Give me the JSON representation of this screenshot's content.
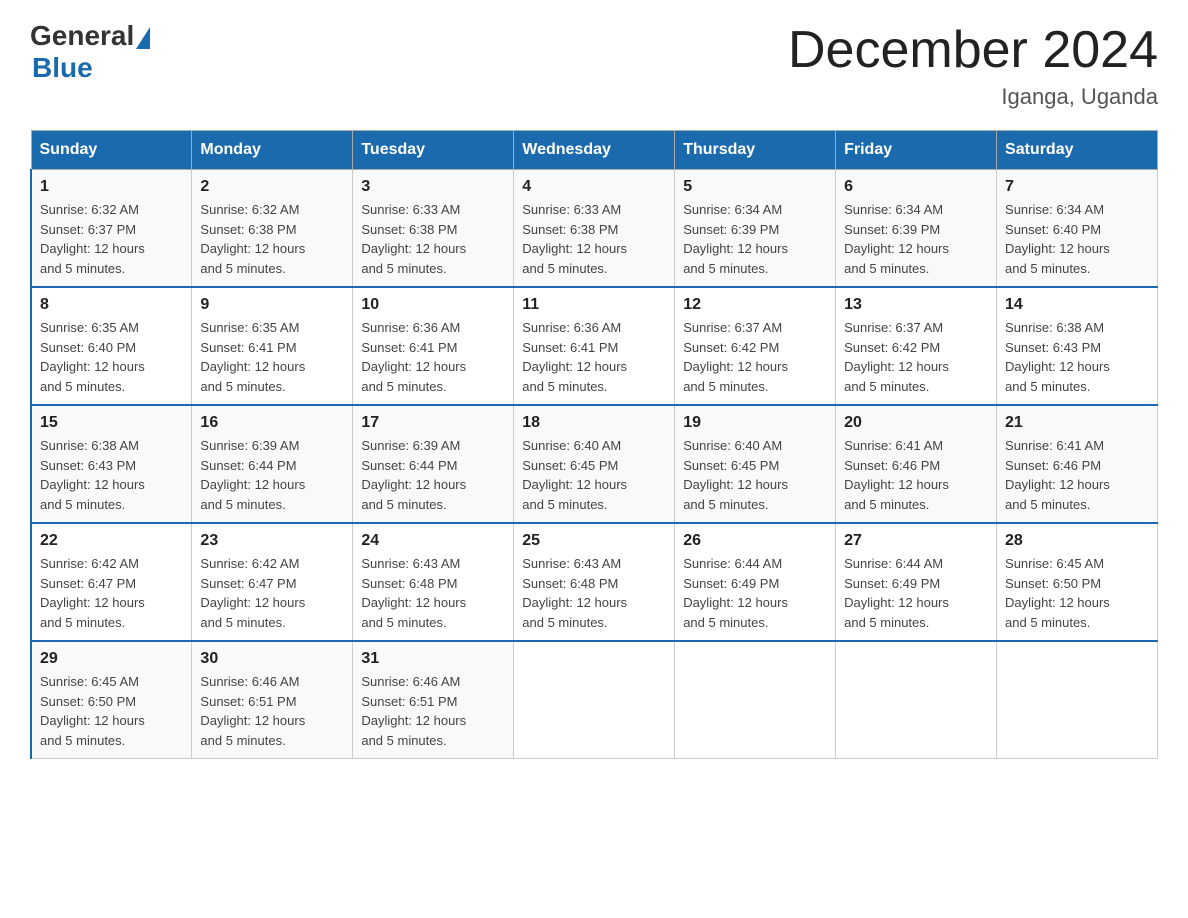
{
  "logo": {
    "general": "General",
    "blue": "Blue"
  },
  "title": "December 2024",
  "location": "Iganga, Uganda",
  "days_of_week": [
    "Sunday",
    "Monday",
    "Tuesday",
    "Wednesday",
    "Thursday",
    "Friday",
    "Saturday"
  ],
  "weeks": [
    [
      {
        "date": "1",
        "sunrise": "6:32 AM",
        "sunset": "6:37 PM",
        "daylight": "12 hours and 5 minutes."
      },
      {
        "date": "2",
        "sunrise": "6:32 AM",
        "sunset": "6:38 PM",
        "daylight": "12 hours and 5 minutes."
      },
      {
        "date": "3",
        "sunrise": "6:33 AM",
        "sunset": "6:38 PM",
        "daylight": "12 hours and 5 minutes."
      },
      {
        "date": "4",
        "sunrise": "6:33 AM",
        "sunset": "6:38 PM",
        "daylight": "12 hours and 5 minutes."
      },
      {
        "date": "5",
        "sunrise": "6:34 AM",
        "sunset": "6:39 PM",
        "daylight": "12 hours and 5 minutes."
      },
      {
        "date": "6",
        "sunrise": "6:34 AM",
        "sunset": "6:39 PM",
        "daylight": "12 hours and 5 minutes."
      },
      {
        "date": "7",
        "sunrise": "6:34 AM",
        "sunset": "6:40 PM",
        "daylight": "12 hours and 5 minutes."
      }
    ],
    [
      {
        "date": "8",
        "sunrise": "6:35 AM",
        "sunset": "6:40 PM",
        "daylight": "12 hours and 5 minutes."
      },
      {
        "date": "9",
        "sunrise": "6:35 AM",
        "sunset": "6:41 PM",
        "daylight": "12 hours and 5 minutes."
      },
      {
        "date": "10",
        "sunrise": "6:36 AM",
        "sunset": "6:41 PM",
        "daylight": "12 hours and 5 minutes."
      },
      {
        "date": "11",
        "sunrise": "6:36 AM",
        "sunset": "6:41 PM",
        "daylight": "12 hours and 5 minutes."
      },
      {
        "date": "12",
        "sunrise": "6:37 AM",
        "sunset": "6:42 PM",
        "daylight": "12 hours and 5 minutes."
      },
      {
        "date": "13",
        "sunrise": "6:37 AM",
        "sunset": "6:42 PM",
        "daylight": "12 hours and 5 minutes."
      },
      {
        "date": "14",
        "sunrise": "6:38 AM",
        "sunset": "6:43 PM",
        "daylight": "12 hours and 5 minutes."
      }
    ],
    [
      {
        "date": "15",
        "sunrise": "6:38 AM",
        "sunset": "6:43 PM",
        "daylight": "12 hours and 5 minutes."
      },
      {
        "date": "16",
        "sunrise": "6:39 AM",
        "sunset": "6:44 PM",
        "daylight": "12 hours and 5 minutes."
      },
      {
        "date": "17",
        "sunrise": "6:39 AM",
        "sunset": "6:44 PM",
        "daylight": "12 hours and 5 minutes."
      },
      {
        "date": "18",
        "sunrise": "6:40 AM",
        "sunset": "6:45 PM",
        "daylight": "12 hours and 5 minutes."
      },
      {
        "date": "19",
        "sunrise": "6:40 AM",
        "sunset": "6:45 PM",
        "daylight": "12 hours and 5 minutes."
      },
      {
        "date": "20",
        "sunrise": "6:41 AM",
        "sunset": "6:46 PM",
        "daylight": "12 hours and 5 minutes."
      },
      {
        "date": "21",
        "sunrise": "6:41 AM",
        "sunset": "6:46 PM",
        "daylight": "12 hours and 5 minutes."
      }
    ],
    [
      {
        "date": "22",
        "sunrise": "6:42 AM",
        "sunset": "6:47 PM",
        "daylight": "12 hours and 5 minutes."
      },
      {
        "date": "23",
        "sunrise": "6:42 AM",
        "sunset": "6:47 PM",
        "daylight": "12 hours and 5 minutes."
      },
      {
        "date": "24",
        "sunrise": "6:43 AM",
        "sunset": "6:48 PM",
        "daylight": "12 hours and 5 minutes."
      },
      {
        "date": "25",
        "sunrise": "6:43 AM",
        "sunset": "6:48 PM",
        "daylight": "12 hours and 5 minutes."
      },
      {
        "date": "26",
        "sunrise": "6:44 AM",
        "sunset": "6:49 PM",
        "daylight": "12 hours and 5 minutes."
      },
      {
        "date": "27",
        "sunrise": "6:44 AM",
        "sunset": "6:49 PM",
        "daylight": "12 hours and 5 minutes."
      },
      {
        "date": "28",
        "sunrise": "6:45 AM",
        "sunset": "6:50 PM",
        "daylight": "12 hours and 5 minutes."
      }
    ],
    [
      {
        "date": "29",
        "sunrise": "6:45 AM",
        "sunset": "6:50 PM",
        "daylight": "12 hours and 5 minutes."
      },
      {
        "date": "30",
        "sunrise": "6:46 AM",
        "sunset": "6:51 PM",
        "daylight": "12 hours and 5 minutes."
      },
      {
        "date": "31",
        "sunrise": "6:46 AM",
        "sunset": "6:51 PM",
        "daylight": "12 hours and 5 minutes."
      },
      null,
      null,
      null,
      null
    ]
  ],
  "labels": {
    "sunrise": "Sunrise:",
    "sunset": "Sunset:",
    "daylight": "Daylight:"
  }
}
